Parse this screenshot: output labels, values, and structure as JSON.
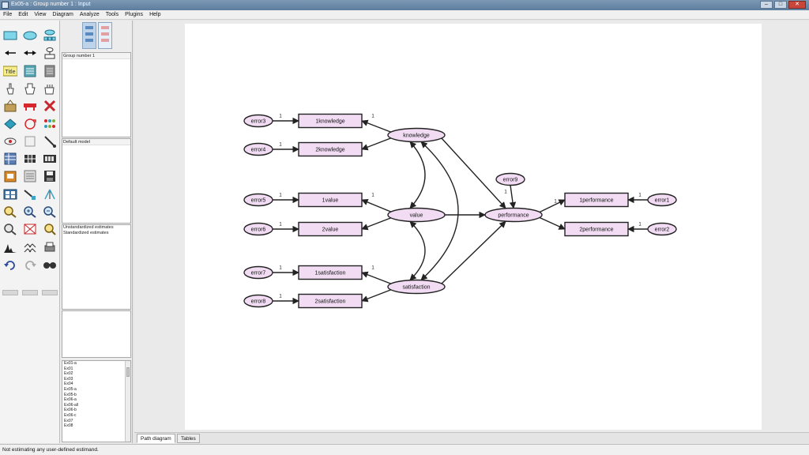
{
  "window": {
    "title": "Ex05-a : Group number 1 : Input",
    "controls": [
      "–",
      "□",
      "✕"
    ]
  },
  "menu": [
    "File",
    "Edit",
    "View",
    "Diagram",
    "Analyze",
    "Tools",
    "Plugins",
    "Help"
  ],
  "toolbox": [
    {
      "row": 0,
      "col": 0,
      "icon": "rectangle-icon"
    },
    {
      "row": 0,
      "col": 1,
      "icon": "ellipse-icon"
    },
    {
      "row": 0,
      "col": 2,
      "icon": "indicator-icon"
    },
    {
      "row": 1,
      "col": 0,
      "icon": "single-arrow-icon"
    },
    {
      "row": 1,
      "col": 1,
      "icon": "double-arrow-icon"
    },
    {
      "row": 1,
      "col": 2,
      "icon": "unique-variable-icon"
    },
    {
      "row": 2,
      "col": 0,
      "icon": "title-icon",
      "text": "Title"
    },
    {
      "row": 2,
      "col": 1,
      "icon": "list-variables-icon"
    },
    {
      "row": 2,
      "col": 2,
      "icon": "list-dataset-icon"
    },
    {
      "row": 3,
      "col": 0,
      "icon": "select-one-icon"
    },
    {
      "row": 3,
      "col": 1,
      "icon": "select-all-icon"
    },
    {
      "row": 3,
      "col": 2,
      "icon": "deselect-icon"
    },
    {
      "row": 4,
      "col": 0,
      "icon": "copy-icon"
    },
    {
      "row": 4,
      "col": 1,
      "icon": "move-icon"
    },
    {
      "row": 4,
      "col": 2,
      "icon": "erase-icon"
    },
    {
      "row": 5,
      "col": 0,
      "icon": "resize-icon"
    },
    {
      "row": 5,
      "col": 1,
      "icon": "rotate-icon"
    },
    {
      "row": 5,
      "col": 2,
      "icon": "reflect-icon"
    },
    {
      "row": 6,
      "col": 0,
      "icon": "move-parameters-icon"
    },
    {
      "row": 6,
      "col": 1,
      "icon": "scroll-icon"
    },
    {
      "row": 6,
      "col": 2,
      "icon": "touch-up-icon"
    },
    {
      "row": 7,
      "col": 0,
      "icon": "data-files-icon"
    },
    {
      "row": 7,
      "col": 1,
      "icon": "analysis-properties-icon"
    },
    {
      "row": 7,
      "col": 2,
      "icon": "calculate-estimates-icon"
    },
    {
      "row": 8,
      "col": 0,
      "icon": "copy-clipboard-icon"
    },
    {
      "row": 8,
      "col": 1,
      "icon": "view-text-icon"
    },
    {
      "row": 8,
      "col": 2,
      "icon": "save-icon"
    },
    {
      "row": 9,
      "col": 0,
      "icon": "object-properties-icon"
    },
    {
      "row": 9,
      "col": 1,
      "icon": "drag-properties-icon"
    },
    {
      "row": 9,
      "col": 2,
      "icon": "preserve-symmetries-icon"
    },
    {
      "row": 10,
      "col": 0,
      "icon": "zoom-area-icon"
    },
    {
      "row": 10,
      "col": 1,
      "icon": "zoom-in-icon"
    },
    {
      "row": 10,
      "col": 2,
      "icon": "zoom-out-icon"
    },
    {
      "row": 11,
      "col": 0,
      "icon": "zoom-page-icon"
    },
    {
      "row": 11,
      "col": 1,
      "icon": "fit-page-icon"
    },
    {
      "row": 11,
      "col": 2,
      "icon": "loupe-icon"
    },
    {
      "row": 12,
      "col": 0,
      "icon": "bayesian-icon"
    },
    {
      "row": 12,
      "col": 1,
      "icon": "multiple-group-icon"
    },
    {
      "row": 12,
      "col": 2,
      "icon": "print-icon"
    },
    {
      "row": 13,
      "col": 0,
      "icon": "undo-icon"
    },
    {
      "row": 13,
      "col": 1,
      "icon": "redo-icon"
    },
    {
      "row": 13,
      "col": 2,
      "icon": "specification-search-icon"
    }
  ],
  "panels": {
    "groups": {
      "items": [
        "Group number 1"
      ]
    },
    "models": {
      "items": [
        "Default model"
      ]
    },
    "estimates": {
      "items": [
        "Unstandardized estimates",
        "Standardized estimates"
      ]
    },
    "files": {
      "items": [
        "Ex01-a",
        "Ex01",
        "Ex02",
        "Ex03",
        "Ex04",
        "Ex05-a",
        "Ex05-b",
        "Ex06-a",
        "Ex06-all",
        "Ex06-b",
        "Ex06-c",
        "Ex07",
        "Ex08"
      ]
    }
  },
  "diagram": {
    "colors": {
      "fill": "#f1dcf3",
      "stroke": "#222222"
    },
    "observed": [
      {
        "id": "k1",
        "label": "1knowledge"
      },
      {
        "id": "k2",
        "label": "2knowledge"
      },
      {
        "id": "v1",
        "label": "1value"
      },
      {
        "id": "v2",
        "label": "2value"
      },
      {
        "id": "s1",
        "label": "1satisfaction"
      },
      {
        "id": "s2",
        "label": "2satisfaction"
      },
      {
        "id": "p1",
        "label": "1performance"
      },
      {
        "id": "p2",
        "label": "2performance"
      }
    ],
    "latent": [
      {
        "id": "know",
        "label": "knowledge"
      },
      {
        "id": "val",
        "label": "value"
      },
      {
        "id": "sat",
        "label": "satisfaction"
      },
      {
        "id": "perf",
        "label": "performance"
      }
    ],
    "errors": [
      {
        "id": "e1",
        "label": "error1"
      },
      {
        "id": "e2",
        "label": "error2"
      },
      {
        "id": "e3",
        "label": "error3"
      },
      {
        "id": "e4",
        "label": "error4"
      },
      {
        "id": "e5",
        "label": "error5"
      },
      {
        "id": "e6",
        "label": "error6"
      },
      {
        "id": "e7",
        "label": "error7"
      },
      {
        "id": "e8",
        "label": "error8"
      },
      {
        "id": "e9",
        "label": "error9"
      }
    ],
    "fixed_label": "1"
  },
  "tabs": [
    "Path diagram",
    "Tables"
  ],
  "status": "Not estimating any user-defined estimand."
}
